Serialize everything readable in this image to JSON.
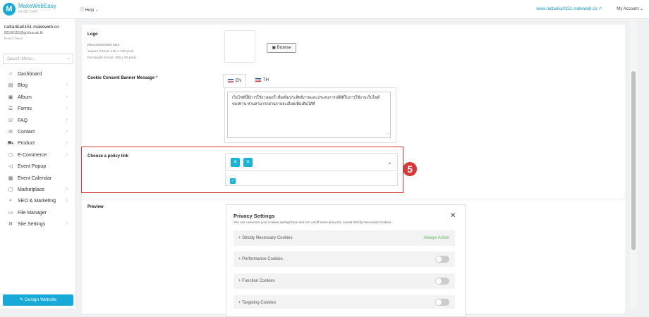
{
  "header": {
    "brand_name": "MakeWebEasy",
    "brand_version": "v4.187.1642",
    "help_label": "Help",
    "site_url": "www.nattarika0151.makeweb.co",
    "account_label": "My Account"
  },
  "user": {
    "name": "nattarika0151.makeweb.co",
    "email": "62160151@go.buu.ac.th",
    "role": "Room Owner"
  },
  "sidebar": {
    "search_placeholder": "Search Menu...",
    "items": [
      {
        "label": "Dashboard",
        "icon": "home-icon",
        "has_chevron": false
      },
      {
        "label": "Blog",
        "icon": "document-icon",
        "has_chevron": true
      },
      {
        "label": "Album",
        "icon": "image-icon",
        "has_chevron": true
      },
      {
        "label": "Forms",
        "icon": "list-icon",
        "has_chevron": true
      },
      {
        "label": "FAQ",
        "icon": "chat-icon",
        "has_chevron": true
      },
      {
        "label": "Contact",
        "icon": "mail-icon",
        "has_chevron": true
      },
      {
        "label": "Product",
        "icon": "cart-icon",
        "has_chevron": true
      },
      {
        "label": "E-Commerce",
        "icon": "tag-icon",
        "has_chevron": true
      },
      {
        "label": "Event Popup",
        "icon": "megaphone-icon",
        "has_chevron": false
      },
      {
        "label": "Event Calendar",
        "icon": "calendar-icon",
        "has_chevron": false
      },
      {
        "label": "Marketplace",
        "icon": "bag-icon",
        "has_chevron": true
      },
      {
        "label": "SEO & Marketing",
        "icon": "search-icon",
        "has_chevron": true
      },
      {
        "label": "File Manager",
        "icon": "folder-icon",
        "has_chevron": false
      },
      {
        "label": "Site Settings",
        "icon": "gear-icon",
        "has_chevron": true
      }
    ],
    "design_button": "Design Website"
  },
  "form": {
    "logo_label": "Logo",
    "recommended_size": "Recommended Size",
    "square_format": "Square format: 160 x 160 pixel",
    "rectangle_format": "Rectangle format: 200 x 50 pixel",
    "browse_label": "Browse",
    "banner_label": "Cookie Consent Banner Message",
    "required_mark": "*",
    "tabs": [
      {
        "label": "EN"
      },
      {
        "label": "TH"
      }
    ],
    "banner_message": "เว็บไซต์นี้มีการใช้งานคุกกี้ เพื่อเพิ่มประสิทธิภาพและประสบการณ์ที่ดีในการใช้งานเว็บไซต์ของท่าน ท่านสามารถอ่านรายละเอียดเพิ่มเติมได้ที่",
    "policy_label": "Choose a policy link",
    "step_number": "5",
    "preview_label": "Preview"
  },
  "preview": {
    "title": "Privacy Settings",
    "subtitle": "You can customize your cookies settings here and turn on/off some privacies, except Strictly Necessary Cookies",
    "rows": [
      {
        "label": "+ Strictly Necessary Cookies",
        "status": "Always Active"
      },
      {
        "label": "+ Performance Cookies"
      },
      {
        "label": "+ Function Cookies"
      },
      {
        "label": "+ Targeting Cookies"
      }
    ]
  },
  "colors": {
    "accent": "#17aad8",
    "highlight": "#d9383a",
    "active_green": "#5cb85c"
  }
}
